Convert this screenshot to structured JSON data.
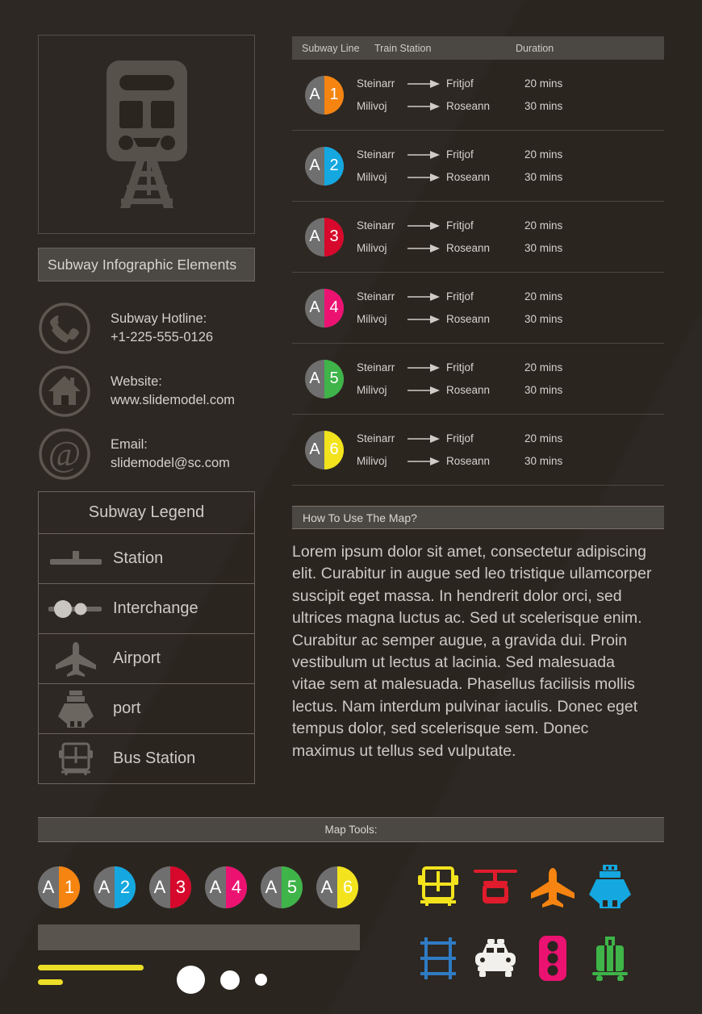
{
  "app": {
    "title": "Subway Infographic Elements",
    "background_color": "#2b2520",
    "panel_color": "#4b4742"
  },
  "hero": {
    "icon": "train-front-icon"
  },
  "contacts": [
    {
      "icon": "phone-icon",
      "line1": "Subway Hotline:",
      "line2": "+1-225-555-0126"
    },
    {
      "icon": "home-icon",
      "line1": "Website:",
      "line2": "www.slidemodel.com"
    },
    {
      "icon": "at-sign-icon",
      "line1": "Email:",
      "line2": "slidemodel@sc.com"
    }
  ],
  "legend": {
    "title": "Subway Legend",
    "items": [
      {
        "icon": "station-icon",
        "label": "Station"
      },
      {
        "icon": "interchange-icon",
        "label": "Interchange"
      },
      {
        "icon": "airport-icon",
        "label": "Airport"
      },
      {
        "icon": "port-icon",
        "label": "port"
      },
      {
        "icon": "bus-station-icon",
        "label": "Bus Station"
      }
    ]
  },
  "table": {
    "headers": {
      "line": "Subway Line",
      "station": "Train Station",
      "duration": "Duration"
    },
    "rows": [
      {
        "badge_letter": "A",
        "badge_number": "1",
        "color": "#f58410",
        "legs": [
          {
            "from": "Steinarr",
            "to": "Fritjof",
            "duration": "20 mins"
          },
          {
            "from": "Milivoj",
            "to": "Roseann",
            "duration": "30 mins"
          }
        ]
      },
      {
        "badge_letter": "A",
        "badge_number": "2",
        "color": "#14a7e0",
        "legs": [
          {
            "from": "Steinarr",
            "to": "Fritjof",
            "duration": "20 mins"
          },
          {
            "from": "Milivoj",
            "to": "Roseann",
            "duration": "30 mins"
          }
        ]
      },
      {
        "badge_letter": "A",
        "badge_number": "3",
        "color": "#d6082b",
        "legs": [
          {
            "from": "Steinarr",
            "to": "Fritjof",
            "duration": "20 mins"
          },
          {
            "from": "Milivoj",
            "to": "Roseann",
            "duration": "30 mins"
          }
        ]
      },
      {
        "badge_letter": "A",
        "badge_number": "4",
        "color": "#ec1272",
        "legs": [
          {
            "from": "Steinarr",
            "to": "Fritjof",
            "duration": "20 mins"
          },
          {
            "from": "Milivoj",
            "to": "Roseann",
            "duration": "30 mins"
          }
        ]
      },
      {
        "badge_letter": "A",
        "badge_number": "5",
        "color": "#3eb449",
        "legs": [
          {
            "from": "Steinarr",
            "to": "Fritjof",
            "duration": "20 mins"
          },
          {
            "from": "Milivoj",
            "to": "Roseann",
            "duration": "30 mins"
          }
        ]
      },
      {
        "badge_letter": "A",
        "badge_number": "6",
        "color": "#f2e31d",
        "legs": [
          {
            "from": "Steinarr",
            "to": "Fritjof",
            "duration": "20 mins"
          },
          {
            "from": "Milivoj",
            "to": "Roseann",
            "duration": "30 mins"
          }
        ]
      }
    ]
  },
  "howto": {
    "title": "How To Use The Map?",
    "body": "Lorem ipsum dolor sit amet, consectetur adipiscing elit. Curabitur in augue sed leo tristique ullamcorper suscipit eget massa. In hendrerit dolor orci, sed ultrices magna luctus ac. Sed ut scelerisque enim. Curabitur ac semper augue, a gravida dui. Proin vestibulum ut lectus at lacinia. Sed malesuada vitae sem at malesuada. Phasellus facilisis mollis lectus. Nam interdum pulvinar iaculis. Donec eget tempus dolor, sed scelerisque sem. Donec maximus ut tellus sed vulputate."
  },
  "map_tools": {
    "title": "Map Tools:",
    "badges": [
      {
        "letter": "A",
        "number": "1",
        "color": "#f58410"
      },
      {
        "letter": "A",
        "number": "2",
        "color": "#14a7e0"
      },
      {
        "letter": "A",
        "number": "3",
        "color": "#d6082b"
      },
      {
        "letter": "A",
        "number": "4",
        "color": "#ec1272"
      },
      {
        "letter": "A",
        "number": "5",
        "color": "#3eb449"
      },
      {
        "letter": "A",
        "number": "6",
        "color": "#f2e31d"
      }
    ],
    "icons": [
      {
        "name": "bus-icon",
        "color": "#f2e31d"
      },
      {
        "name": "cable-car-icon",
        "color": "#e01b2c"
      },
      {
        "name": "airplane-icon",
        "color": "#f58410"
      },
      {
        "name": "ship-icon",
        "color": "#14a7e0"
      },
      {
        "name": "railway-track-icon",
        "color": "#2f7bc4"
      },
      {
        "name": "taxi-icon",
        "color": "#f2f0ec"
      },
      {
        "name": "traffic-light-icon",
        "color": "#ec1272"
      },
      {
        "name": "luggage-icon",
        "color": "#3eb449"
      }
    ],
    "accent_line_color": "#edde28",
    "dot_color": "#ffffff"
  }
}
